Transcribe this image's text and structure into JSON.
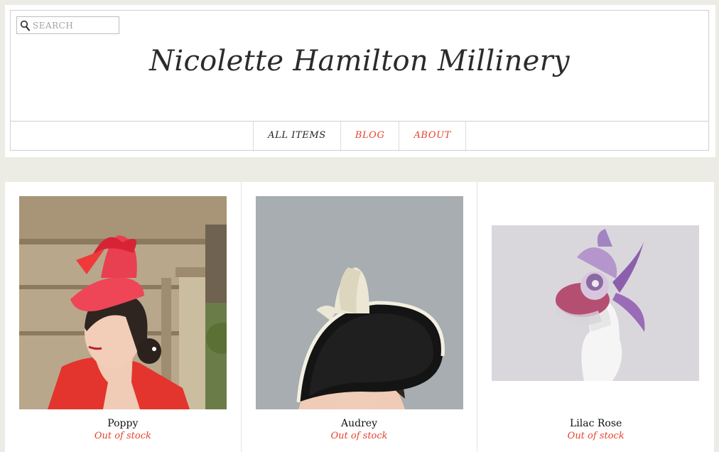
{
  "search": {
    "placeholder": "SEARCH"
  },
  "site": {
    "title": "Nicolette Hamilton Millinery"
  },
  "nav": [
    {
      "label": "ALL ITEMS",
      "active": true
    },
    {
      "label": "BLOG",
      "active": false
    },
    {
      "label": "ABOUT",
      "active": false
    }
  ],
  "products": [
    {
      "name": "Poppy",
      "status": "Out of stock"
    },
    {
      "name": "Audrey",
      "status": "Out of stock"
    },
    {
      "name": "Lilac Rose",
      "status": "Out of stock"
    }
  ],
  "colors": {
    "accent": "#e8412c",
    "background": "#ecebe4",
    "text": "#2b2b2b"
  },
  "icons": {
    "search": "search-icon"
  }
}
